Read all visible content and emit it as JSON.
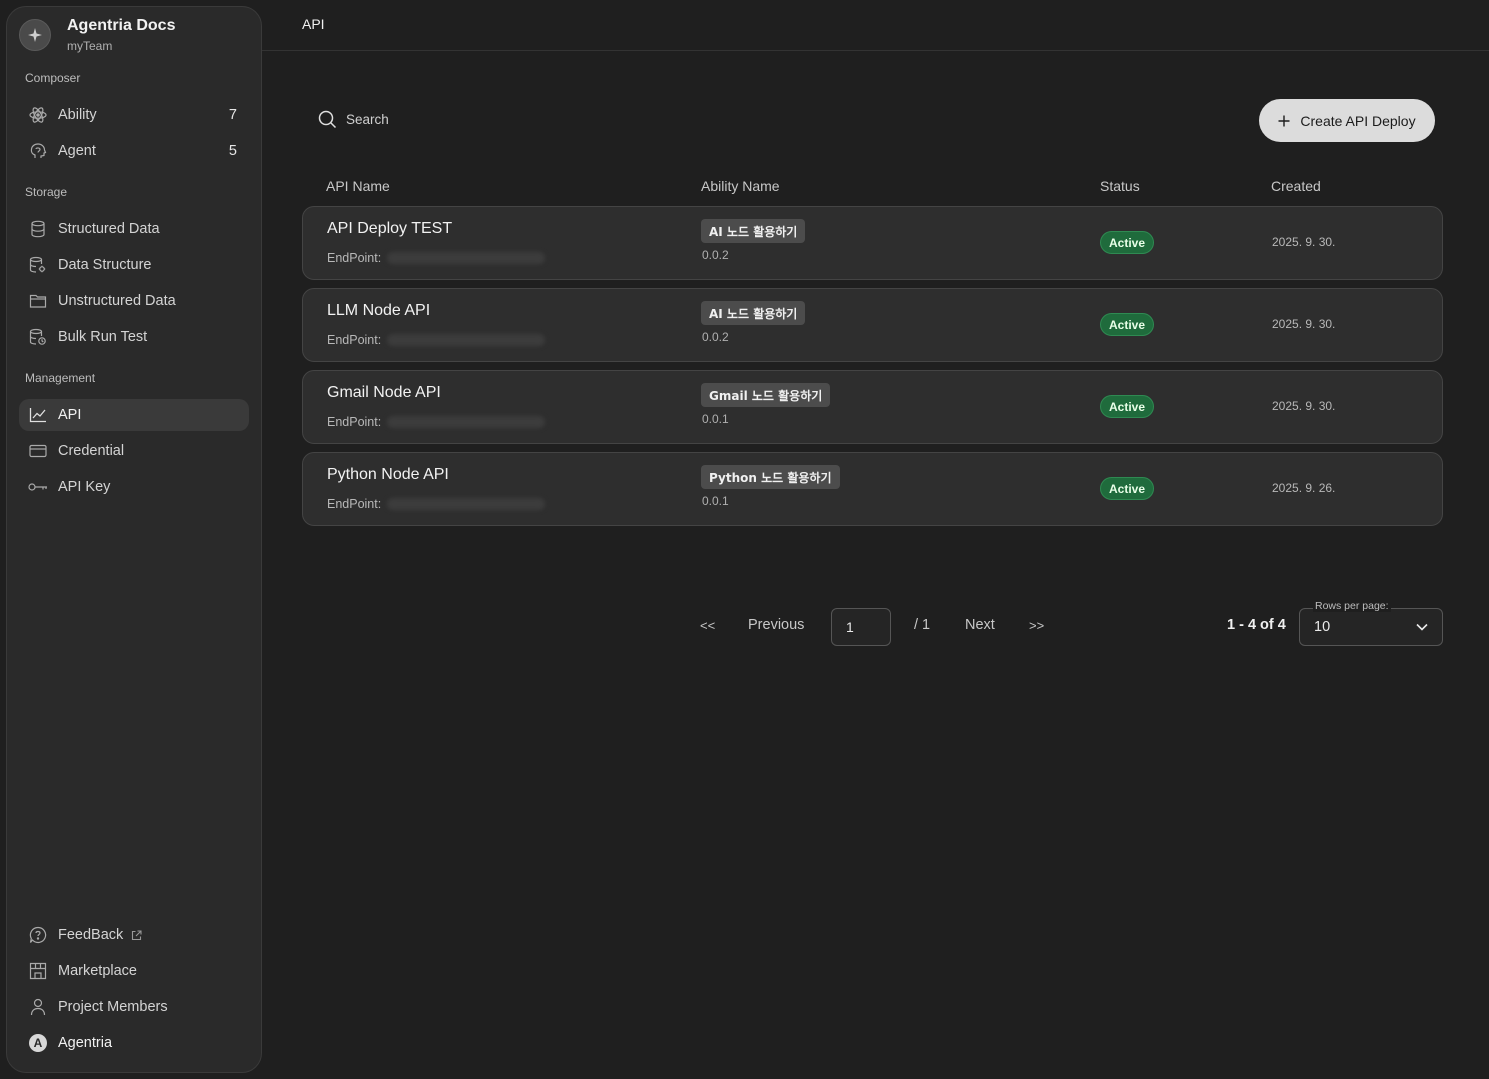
{
  "team": {
    "name": "Agentria Docs",
    "sub": "myTeam",
    "logo_icon": "sparkle-icon"
  },
  "sections": {
    "composer": "Composer",
    "storage": "Storage",
    "management": "Management"
  },
  "nav": {
    "ability": {
      "label": "Ability",
      "count": "7"
    },
    "agent": {
      "label": "Agent",
      "count": "5"
    },
    "structured_data": "Structured Data",
    "data_structure": "Data Structure",
    "unstructured_data": "Unstructured Data",
    "bulk_run_test": "Bulk Run Test",
    "api": "API",
    "credential": "Credential",
    "api_key": "API Key",
    "feedback": "FeedBack",
    "marketplace": "Marketplace",
    "project_members": "Project Members",
    "user": {
      "name": "Agentria",
      "initial": "A"
    }
  },
  "header": {
    "title": "API"
  },
  "search": {
    "placeholder": "Search"
  },
  "create_button": "Create API Deploy",
  "table": {
    "columns": [
      "API Name",
      "Ability Name",
      "Status",
      "Created"
    ],
    "endpoint_label": "EndPoint:",
    "rows": [
      {
        "name": "API Deploy TEST",
        "ability": "AI 노드 활용하기",
        "version": "0.0.2",
        "status": "Active",
        "created": "2025. 9. 30."
      },
      {
        "name": "LLM Node API",
        "ability": "AI 노드 활용하기",
        "version": "0.0.2",
        "status": "Active",
        "created": "2025. 9. 30."
      },
      {
        "name": "Gmail Node API",
        "ability": "Gmail 노드 활용하기",
        "version": "0.0.1",
        "status": "Active",
        "created": "2025. 9. 30."
      },
      {
        "name": "Python Node API",
        "ability": "Python 노드 활용하기",
        "version": "0.0.1",
        "status": "Active",
        "created": "2025. 9. 26."
      }
    ]
  },
  "pagination": {
    "first": "<<",
    "previous": "Previous",
    "current_page": "1",
    "total": "/ 1",
    "next": "Next",
    "last": ">>",
    "range": "1 - 4 of 4",
    "rows_per_page_label": "Rows per page:",
    "rows_per_page": "10"
  },
  "colors": {
    "background": "#1f1f1f",
    "sidebar": "#2a2a2a",
    "status_active": "#1f6b3c",
    "button": "#dcdcdc"
  }
}
